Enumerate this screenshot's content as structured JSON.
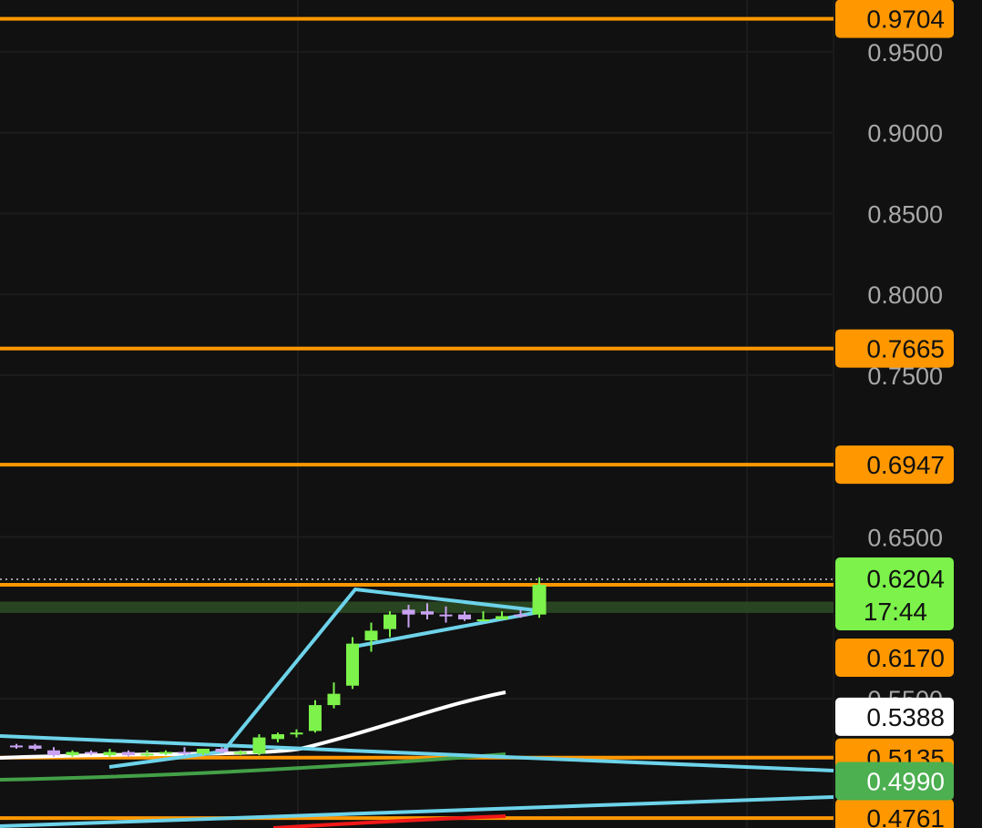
{
  "chart_data": {
    "type": "candlestick",
    "ylim": [
      0.47,
      0.982
    ],
    "y_ticks": [
      "0.9500",
      "0.9000",
      "0.8500",
      "0.8000",
      "0.7500",
      "0.6500",
      "0.5500"
    ],
    "price_levels": [
      {
        "label": "0.9704",
        "value": 0.9704,
        "color": "#ff9800"
      },
      {
        "label": "0.7665",
        "value": 0.7665,
        "color": "#ff9800"
      },
      {
        "label": "0.6947",
        "value": 0.6947,
        "color": "#ff9800"
      },
      {
        "label": "0.6170",
        "value": 0.6204,
        "color": "#ff9800"
      },
      {
        "label": "0.5135",
        "value": 0.5135,
        "color": "#ff9800"
      },
      {
        "label": "0.4761",
        "value": 0.4761,
        "color": "#ff9800"
      }
    ],
    "current": {
      "price": "0.6204",
      "countdown": "17:44",
      "value": 0.6204,
      "color": "#7cf24a"
    },
    "ma_tags": [
      {
        "label": "0.5388",
        "value": 0.5388,
        "bg": "#ffffff",
        "fg": "#111111"
      },
      {
        "label": "0.4990",
        "value": 0.499,
        "bg": "#4caf50",
        "fg": "#ffffff"
      }
    ],
    "zone": {
      "from": 0.603,
      "to": 0.61,
      "color": "#2c4a23"
    },
    "candles": [
      {
        "o": 0.521,
        "h": 0.522,
        "l": 0.519,
        "c": 0.52
      },
      {
        "o": 0.521,
        "h": 0.522,
        "l": 0.518,
        "c": 0.519
      },
      {
        "o": 0.518,
        "h": 0.52,
        "l": 0.514,
        "c": 0.515
      },
      {
        "o": 0.515,
        "h": 0.518,
        "l": 0.514,
        "c": 0.517
      },
      {
        "o": 0.517,
        "h": 0.518,
        "l": 0.515,
        "c": 0.516
      },
      {
        "o": 0.515,
        "h": 0.519,
        "l": 0.514,
        "c": 0.517
      },
      {
        "o": 0.517,
        "h": 0.518,
        "l": 0.514,
        "c": 0.515
      },
      {
        "o": 0.515,
        "h": 0.518,
        "l": 0.514,
        "c": 0.516
      },
      {
        "o": 0.516,
        "h": 0.518,
        "l": 0.515,
        "c": 0.517
      },
      {
        "o": 0.517,
        "h": 0.52,
        "l": 0.515,
        "c": 0.516
      },
      {
        "o": 0.516,
        "h": 0.519,
        "l": 0.515,
        "c": 0.519
      },
      {
        "o": 0.519,
        "h": 0.52,
        "l": 0.516,
        "c": 0.517
      },
      {
        "o": 0.517,
        "h": 0.518,
        "l": 0.515,
        "c": 0.517
      },
      {
        "o": 0.516,
        "h": 0.528,
        "l": 0.515,
        "c": 0.526
      },
      {
        "o": 0.525,
        "h": 0.529,
        "l": 0.523,
        "c": 0.528
      },
      {
        "o": 0.528,
        "h": 0.531,
        "l": 0.526,
        "c": 0.529
      },
      {
        "o": 0.53,
        "h": 0.549,
        "l": 0.529,
        "c": 0.546
      },
      {
        "o": 0.546,
        "h": 0.56,
        "l": 0.544,
        "c": 0.553
      },
      {
        "o": 0.558,
        "h": 0.588,
        "l": 0.556,
        "c": 0.584
      },
      {
        "o": 0.586,
        "h": 0.597,
        "l": 0.579,
        "c": 0.592
      },
      {
        "o": 0.593,
        "h": 0.604,
        "l": 0.588,
        "c": 0.602
      },
      {
        "o": 0.605,
        "h": 0.608,
        "l": 0.594,
        "c": 0.602
      },
      {
        "o": 0.604,
        "h": 0.609,
        "l": 0.599,
        "c": 0.602
      },
      {
        "o": 0.602,
        "h": 0.607,
        "l": 0.597,
        "c": 0.601
      },
      {
        "o": 0.602,
        "h": 0.604,
        "l": 0.598,
        "c": 0.599
      },
      {
        "o": 0.599,
        "h": 0.604,
        "l": 0.598,
        "c": 0.599
      },
      {
        "o": 0.599,
        "h": 0.604,
        "l": 0.599,
        "c": 0.601
      },
      {
        "o": 0.602,
        "h": 0.605,
        "l": 0.6,
        "c": 0.601
      },
      {
        "o": 0.602,
        "h": 0.625,
        "l": 0.6,
        "c": 0.6204
      }
    ]
  },
  "colors": {
    "bull": "#7cf24a",
    "bear": "#c9a2f2",
    "trendline": "#6dd3ea",
    "ma_fast": "#ffffff",
    "ma_mid": "#43a047",
    "ma_slow": "#f21818",
    "grid": "#1c1c1c"
  }
}
